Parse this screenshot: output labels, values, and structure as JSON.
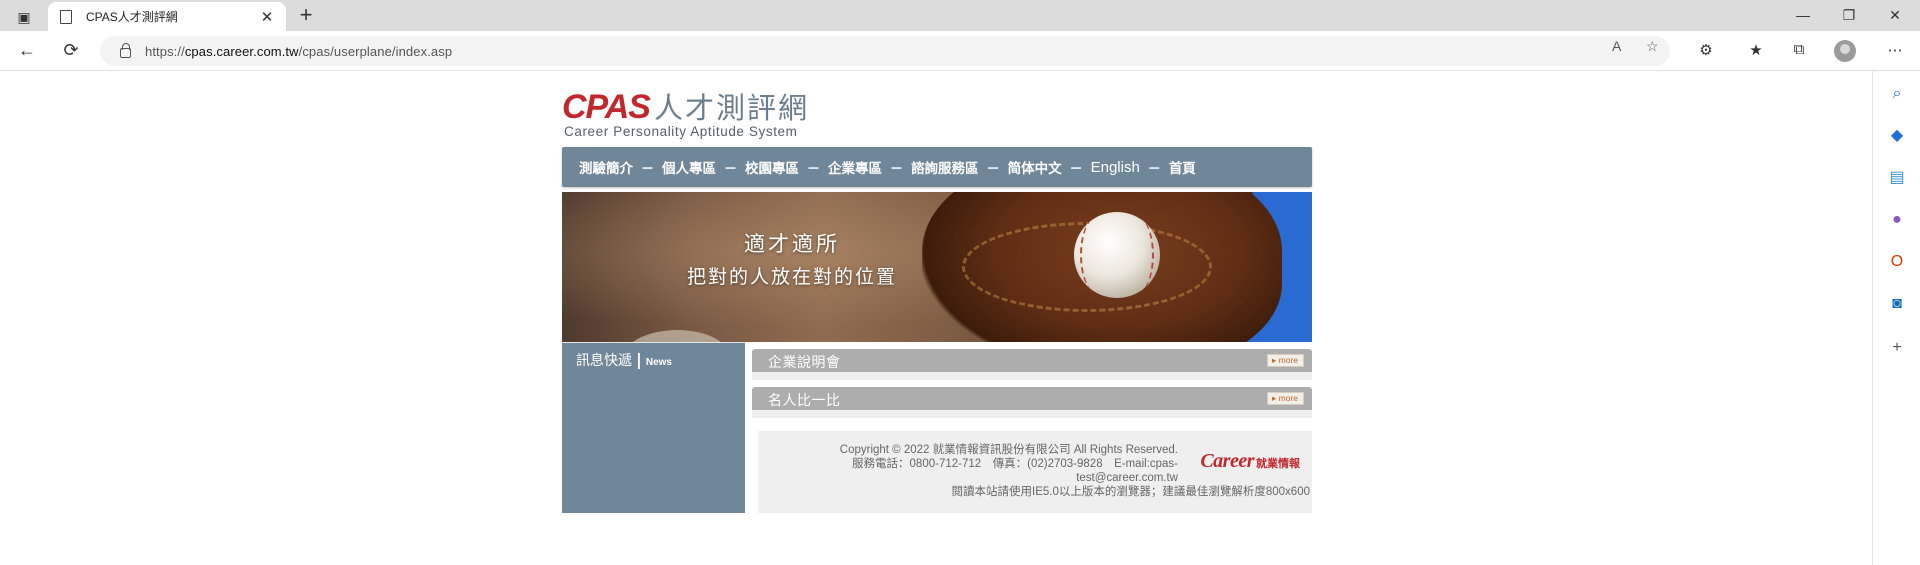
{
  "browser": {
    "tab_title": "CPAS人才測評網",
    "url_scheme": "https://",
    "url_host": "cpas.career.com.tw",
    "url_path": "/cpas/userplane/index.asp",
    "icons": {
      "back": "←",
      "reload": "⟳",
      "close_tab": "✕",
      "new_tab": "+",
      "minimize": "—",
      "restore": "❐",
      "close_window": "✕",
      "read_aloud": "A",
      "favorite": "☆",
      "extensions": "⚙",
      "favorites_bar": "★",
      "collections": "⧉",
      "more": "⋯",
      "tabs_menu": "▣"
    }
  },
  "sidebar": {
    "icons": [
      "search-icon",
      "shopping-tag-icon",
      "tools-icon",
      "people-icon",
      "office-icon",
      "outlook-icon",
      "add-icon"
    ],
    "glyphs": [
      "⌕",
      "◆",
      "▤",
      "●",
      "O",
      "◙",
      "+"
    ],
    "colors": [
      "#1f6fd6",
      "#1f6fd6",
      "#2f8fd8",
      "#8a57c4",
      "#d83b01",
      "#0f6cbd",
      "#555555"
    ]
  },
  "site": {
    "logo_main": "CPAS",
    "logo_cn": "人才測評網",
    "logo_sub": "Career Personality Aptitude System",
    "nav": [
      "測驗簡介",
      "個人專區",
      "校園專區",
      "企業專區",
      "諮詢服務區",
      "简体中文",
      "English",
      "首頁"
    ],
    "nav_separator": "－",
    "banner": {
      "line1": "適才適所",
      "line2": "把對的人放在對的位置"
    },
    "news": {
      "title": "訊息快遞",
      "bar": "|",
      "title_en": "News"
    },
    "sections": [
      {
        "label": "企業說明會",
        "more": "▸ more"
      },
      {
        "label": "名人比一比",
        "more": "▸ more"
      }
    ],
    "footer": {
      "copyright": "Copyright © 2022 就業情報資訊股份有限公司 All Rights Reserved.",
      "contact": "服務電話：0800-712-712　傳真：(02)2703-9828　E-mail:cpas-",
      "contact_cont": "test@career.com.tw",
      "browser_note": "閱讀本站請使用IE5.0以上版本的瀏覽器；建議最佳瀏覽解析度800x600",
      "brand_en": "Career",
      "brand_cn": "就業情報"
    },
    "colors": {
      "brand_red": "#c1272d",
      "nav_blue_gray": "#6f8799",
      "section_gray": "#adadad"
    }
  }
}
